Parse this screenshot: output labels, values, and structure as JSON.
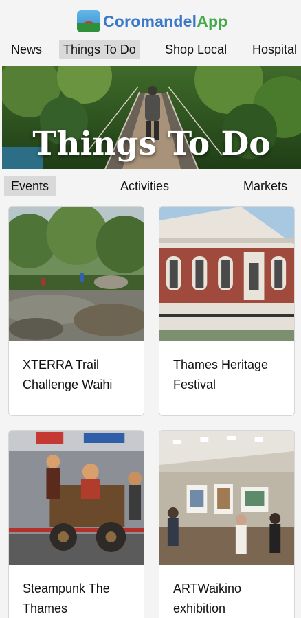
{
  "app": {
    "name_part1": "Coromandel",
    "name_part2": "App"
  },
  "nav": [
    "News",
    "Things To Do",
    "Shop Local",
    "Hospital"
  ],
  "nav_active": 1,
  "hero": {
    "title": "Things To Do"
  },
  "subnav": [
    "Events",
    "Activities",
    "Markets"
  ],
  "subnav_active": 0,
  "cards": [
    {
      "title": "XTERRA Trail Challenge Waihi"
    },
    {
      "title": "Thames Heritage Festival"
    },
    {
      "title": "Steampunk The Thames"
    },
    {
      "title": "ARTWaikino exhibition"
    }
  ],
  "colors": {
    "brand_blue": "#3a78c9",
    "brand_green": "#43a94a",
    "active_tab_bg": "#d9d9d9"
  }
}
